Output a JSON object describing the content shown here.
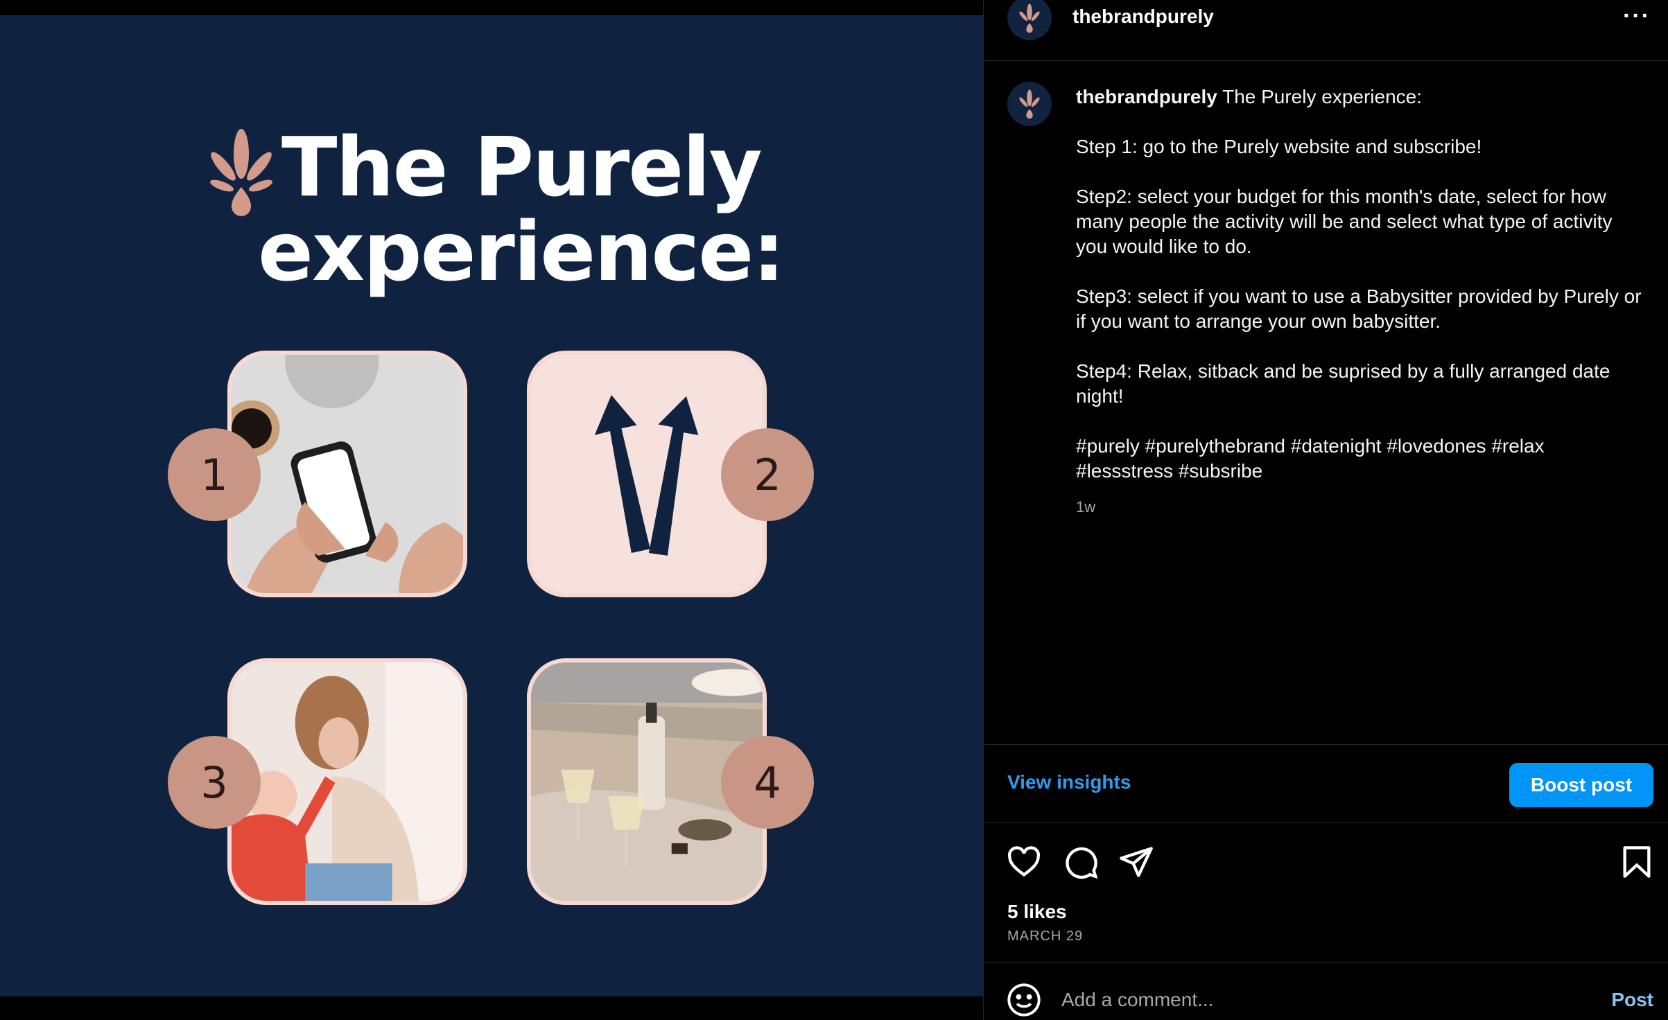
{
  "post": {
    "username": "thebrandpurely",
    "more_icon": "more-horizontal-icon",
    "colors": {
      "accent": "#0095f6",
      "link": "#2c9df0",
      "poster_bg": "#0f2340",
      "badge": "#c99584",
      "tile": "#f7e1dc"
    }
  },
  "image": {
    "title_line1": "The Purely",
    "title_line2": "experience:",
    "steps": [
      "1",
      "2",
      "3",
      "4"
    ]
  },
  "caption": {
    "username": "thebrandpurely",
    "intro": " The Purely experience:",
    "step1": "Step 1: go to the Purely website and subscribe!",
    "step2": "Step2: select your budget for this month's date, select for how many people the activity will be and select what type of activity you would like to do.",
    "step3": "Step3: select if you want to use a Babysitter provided by Purely or if you want to arrange your own babysitter.",
    "step4": "Step4: Relax, sitback and be suprised by a fully arranged date night!",
    "hashtags": "#purely #purelythebrand #datenight #lovedones #relax #lessstress #subsribe",
    "time": "1w"
  },
  "insights": {
    "view_label": "View insights",
    "boost_label": "Boost post"
  },
  "actions": {
    "likes": "5 likes",
    "date": "MARCH 29"
  },
  "comment": {
    "placeholder": "Add a comment...",
    "post_label": "Post"
  }
}
